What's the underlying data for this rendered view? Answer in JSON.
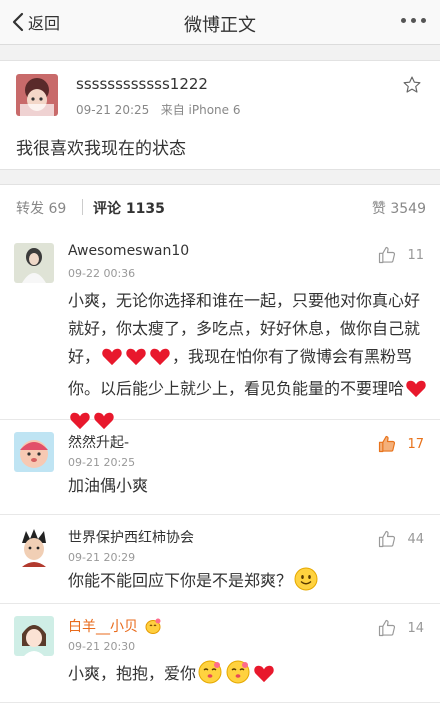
{
  "nav": {
    "back_label": "返回",
    "title": "微博正文"
  },
  "post": {
    "username": "ssssssssssss1222",
    "time": "09-21 20:25",
    "source": "来自 iPhone 6",
    "content": "我很喜欢我现在的状态"
  },
  "tabs": {
    "repost_label": "转发",
    "repost_count": "69",
    "comment_label": "评论",
    "comment_count": "1135",
    "like_label": "赞",
    "like_count": "3549"
  },
  "comments": [
    {
      "name": "Awesomeswan10",
      "time": "09-22 00:36",
      "likes": "11",
      "text_1": "小爽，无论你选择和谁在一起，只要他对你真心好就好，你太瘦了，多吃点，好好休息，做你自己就好，",
      "text_2": "，我现在怕你有了微博会有黑粉骂你。以后能少上就少上，看见负能量的不要理哈"
    },
    {
      "name": "然然升起-",
      "time": "09-21 20:25",
      "likes": "17",
      "text": "加油偶小爽"
    },
    {
      "name": "世界保护西红柿协会",
      "time": "09-21 20:29",
      "likes": "44",
      "text": "你能不能回应下你是不是郑爽？"
    },
    {
      "name": "白羊__小贝",
      "time": "09-21 20:30",
      "likes": "14",
      "text": "小爽，抱抱，爱你"
    }
  ],
  "colors": {
    "accent_orange": "#e86b1c",
    "heart_red": "#e8182c",
    "background": "#f2f2f2"
  },
  "icons": [
    "back-chevron-icon",
    "more-dots-icon",
    "star-icon",
    "thumb-up-icon",
    "heart-emoji",
    "smile-emoji",
    "kiss-emoji",
    "vip-badge-icon"
  ]
}
